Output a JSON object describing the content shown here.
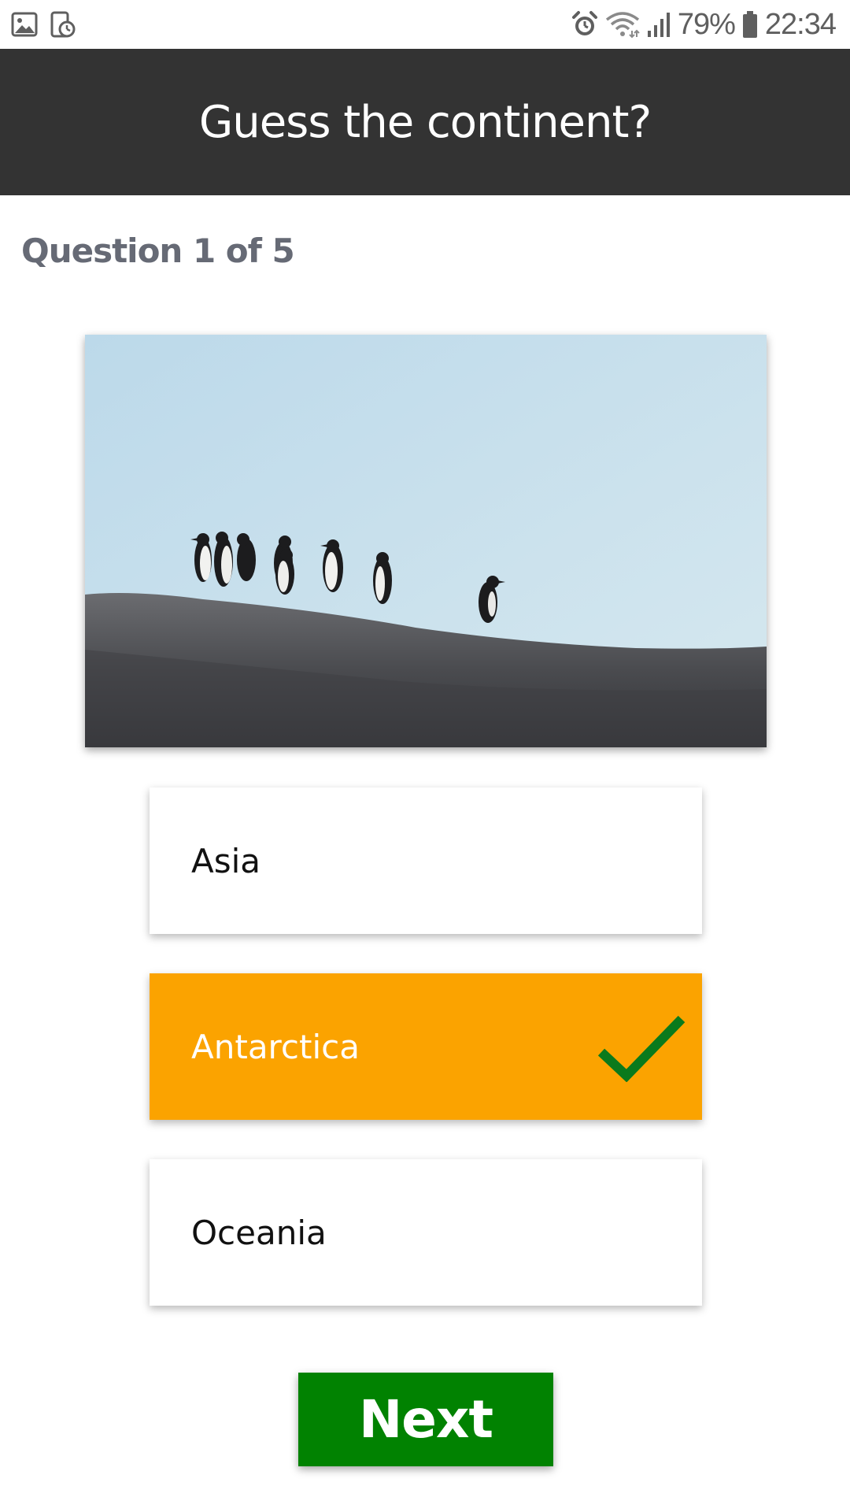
{
  "status_bar": {
    "left_icons": [
      "gallery-icon",
      "screen-timer-icon"
    ],
    "right_icons": [
      "alarm-icon",
      "wifi-icon",
      "signal-icon",
      "battery-icon"
    ],
    "battery_percent": "79%",
    "time": "22:34"
  },
  "app_bar": {
    "title": "Guess the continent?"
  },
  "quiz": {
    "progress_label": "Question 1 of 5",
    "image_subject": "penguins",
    "answers": [
      {
        "label": "Asia",
        "selected": false
      },
      {
        "label": "Antarctica",
        "selected": true,
        "status_icon": "check-icon"
      },
      {
        "label": "Oceania",
        "selected": false
      }
    ],
    "next_label": "Next"
  },
  "colors": {
    "app_bar_bg": "#333333",
    "selected_answer_bg": "#fba300",
    "next_button_bg": "#018201",
    "check_color": "#0a7a1c",
    "counter_text": "#666a75"
  }
}
